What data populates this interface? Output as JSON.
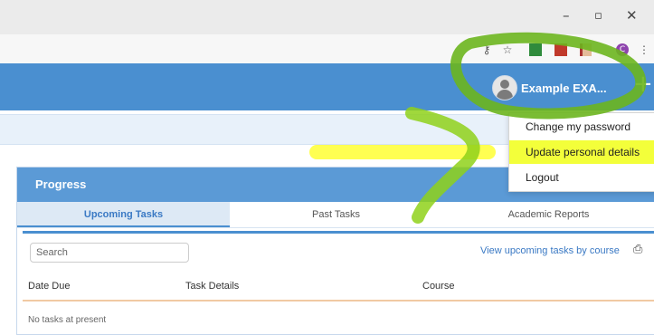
{
  "window": {
    "controls": [
      "–",
      "▫",
      "✕"
    ]
  },
  "toolbar": {
    "icons": [
      "key-icon",
      "star-icon",
      "extension-icon",
      "pdf-icon",
      "flag-icon",
      "profile-icon",
      "menu-icon"
    ],
    "profile_initial": "C"
  },
  "app": {
    "user": {
      "name": "Example EXA..."
    },
    "add_label": "+"
  },
  "user_menu": {
    "items": [
      {
        "label": "Change my password"
      },
      {
        "label": "Update personal details"
      },
      {
        "label": "Logout"
      }
    ]
  },
  "progress": {
    "title": "Progress",
    "tabs": [
      {
        "label": "Upcoming Tasks",
        "active": true
      },
      {
        "label": "Past Tasks",
        "active": false
      },
      {
        "label": "Academic Reports",
        "active": false
      }
    ],
    "search_placeholder": "Search",
    "view_link": "View upcoming tasks by course",
    "columns": [
      "Date Due",
      "Task Details",
      "Course"
    ],
    "empty_message": "No tasks at present"
  },
  "colors": {
    "app_blue": "#4a8fd0",
    "highlight_yellow": "#ffff33",
    "annotation_green": "#6bb51e"
  }
}
